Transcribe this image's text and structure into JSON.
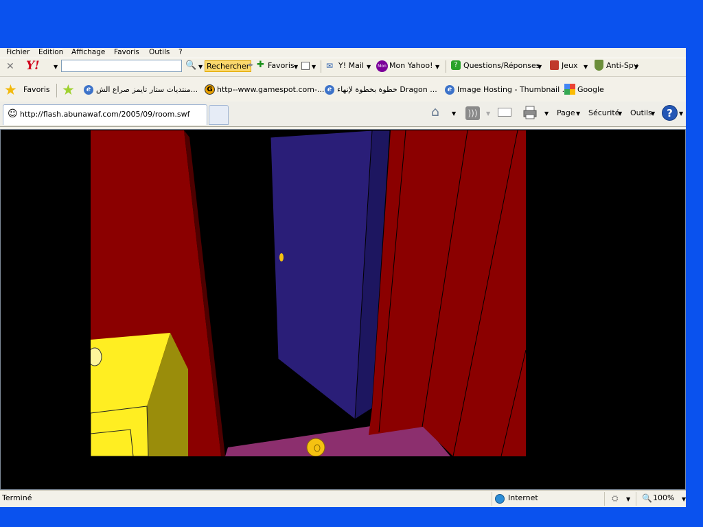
{
  "menubar": {
    "items": [
      "Fichier",
      "Edition",
      "Affichage",
      "Favoris",
      "Outils",
      "?"
    ]
  },
  "yahoo_toolbar": {
    "close_glyph": "✕",
    "logo": "Y!",
    "search_value": "",
    "search_button": "Rechercher",
    "favoris": "Favoris",
    "mail": "Y! Mail",
    "mon_yahoo_badge": "Mon",
    "mon_yahoo": "Mon Yahoo!",
    "questions": "Questions/Réponses",
    "jeux": "Jeux",
    "antispy": "Anti-Spy"
  },
  "links_bar": {
    "favoris": "Favoris",
    "links": [
      {
        "label": "منتديات ستار تايمز صراع الش...",
        "icon": "ie-page-icon"
      },
      {
        "label": "http--www.gamespot.com-...",
        "icon": "gamespot-icon"
      },
      {
        "label": "خطوة بخطوة لإنهاء Dragon ...",
        "icon": "ie-page-icon"
      },
      {
        "label": "Image Hosting - Thumbnail ...",
        "icon": "ie-page-icon"
      },
      {
        "label": "Google",
        "icon": "google-icon"
      }
    ]
  },
  "tab": {
    "url": "http://flash.abunawaf.com/2005/09/room.swf"
  },
  "command_bar": {
    "page": "Page",
    "securite": "Sécurité",
    "outils": "Outils"
  },
  "status": {
    "text": "Terminé",
    "zone": "Internet",
    "zoom": "100%"
  },
  "colors": {
    "desktop": "#0a52ee",
    "wall_red": "#8b0000",
    "door_blue": "#2a1e78",
    "floor": "#8c2f6e",
    "cabinet": "#ffee22",
    "knob": "#f5c211"
  }
}
